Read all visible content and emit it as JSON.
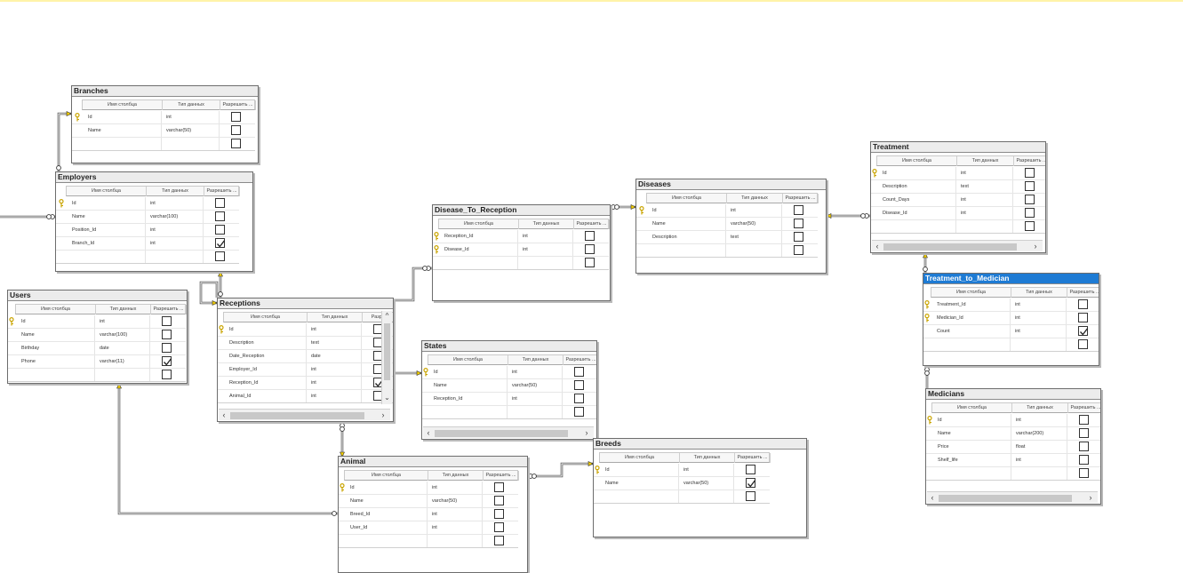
{
  "columns_header": {
    "name": "Имя столбца",
    "type": "Тип данных",
    "nullable": "Разрешить ..."
  },
  "tables": [
    {
      "id": "branches",
      "title": "Branches",
      "rows": [
        {
          "name": "Id",
          "type": "int",
          "pk": true,
          "nullable": false
        },
        {
          "name": "Name",
          "type": "varchar(50)",
          "pk": false,
          "nullable": false
        },
        {
          "name": "",
          "type": "",
          "pk": false,
          "nullable": false
        }
      ]
    },
    {
      "id": "employers",
      "title": "Employers",
      "rows": [
        {
          "name": "Id",
          "type": "int",
          "pk": true,
          "nullable": false
        },
        {
          "name": "Name",
          "type": "varchar(100)",
          "pk": false,
          "nullable": false
        },
        {
          "name": "Position_Id",
          "type": "int",
          "pk": false,
          "nullable": false
        },
        {
          "name": "Branch_Id",
          "type": "int",
          "pk": false,
          "nullable": true
        },
        {
          "name": "",
          "type": "",
          "pk": false,
          "nullable": false
        }
      ]
    },
    {
      "id": "users",
      "title": "Users",
      "rows": [
        {
          "name": "Id",
          "type": "int",
          "pk": true,
          "nullable": false
        },
        {
          "name": "Name",
          "type": "varchar(100)",
          "pk": false,
          "nullable": false
        },
        {
          "name": "Birthday",
          "type": "date",
          "pk": false,
          "nullable": false
        },
        {
          "name": "Phone",
          "type": "varchar(11)",
          "pk": false,
          "nullable": true
        },
        {
          "name": "",
          "type": "",
          "pk": false,
          "nullable": false
        }
      ]
    },
    {
      "id": "receptions",
      "title": "Receptions",
      "header_nullable": "Разреш",
      "rows": [
        {
          "name": "Id",
          "type": "int",
          "pk": true,
          "nullable": false
        },
        {
          "name": "Description",
          "type": "text",
          "pk": false,
          "nullable": false
        },
        {
          "name": "Date_Reception",
          "type": "date",
          "pk": false,
          "nullable": false
        },
        {
          "name": "Employer_Id",
          "type": "int",
          "pk": false,
          "nullable": false
        },
        {
          "name": "Reception_Id",
          "type": "int",
          "pk": false,
          "nullable": true
        },
        {
          "name": "Animal_Id",
          "type": "int",
          "pk": false,
          "nullable": false
        }
      ]
    },
    {
      "id": "disease_to_reception",
      "title": "Disease_To_Reception",
      "rows": [
        {
          "name": "Reception_Id",
          "type": "int",
          "pk": true,
          "nullable": false
        },
        {
          "name": "Disease_Id",
          "type": "int",
          "pk": true,
          "nullable": false
        },
        {
          "name": "",
          "type": "",
          "pk": false,
          "nullable": false
        }
      ]
    },
    {
      "id": "diseases",
      "title": "Diseases",
      "rows": [
        {
          "name": "Id",
          "type": "int",
          "pk": true,
          "nullable": false
        },
        {
          "name": "Name",
          "type": "varchar(50)",
          "pk": false,
          "nullable": false
        },
        {
          "name": "Description",
          "type": "text",
          "pk": false,
          "nullable": false
        },
        {
          "name": "",
          "type": "",
          "pk": false,
          "nullable": false
        }
      ]
    },
    {
      "id": "treatment",
      "title": "Treatment",
      "rows": [
        {
          "name": "Id",
          "type": "int",
          "pk": true,
          "nullable": false
        },
        {
          "name": "Description",
          "type": "text",
          "pk": false,
          "nullable": false
        },
        {
          "name": "Count_Days",
          "type": "int",
          "pk": false,
          "nullable": false
        },
        {
          "name": "Disease_Id",
          "type": "int",
          "pk": false,
          "nullable": false
        },
        {
          "name": "",
          "type": "",
          "pk": false,
          "nullable": false
        }
      ]
    },
    {
      "id": "treatment_to_medician",
      "title": "Treatment_to_Medician",
      "selected": true,
      "rows": [
        {
          "name": "Treatment_Id",
          "type": "int",
          "pk": true,
          "nullable": false
        },
        {
          "name": "Medician_Id",
          "type": "int",
          "pk": true,
          "nullable": false
        },
        {
          "name": "Count",
          "type": "int",
          "pk": false,
          "nullable": true
        },
        {
          "name": "",
          "type": "",
          "pk": false,
          "nullable": false
        }
      ]
    },
    {
      "id": "medicians",
      "title": "Medicians",
      "rows": [
        {
          "name": "Id",
          "type": "int",
          "pk": true,
          "nullable": false
        },
        {
          "name": "Name",
          "type": "varchar(200)",
          "pk": false,
          "nullable": false
        },
        {
          "name": "Price",
          "type": "float",
          "pk": false,
          "nullable": false
        },
        {
          "name": "Shelf_life",
          "type": "int",
          "pk": false,
          "nullable": false
        },
        {
          "name": "",
          "type": "",
          "pk": false,
          "nullable": false
        }
      ]
    },
    {
      "id": "states",
      "title": "States",
      "rows": [
        {
          "name": "Id",
          "type": "int",
          "pk": true,
          "nullable": false
        },
        {
          "name": "Name",
          "type": "varchar(50)",
          "pk": false,
          "nullable": false
        },
        {
          "name": "Reception_Id",
          "type": "int",
          "pk": false,
          "nullable": false
        },
        {
          "name": "",
          "type": "",
          "pk": false,
          "nullable": false
        }
      ]
    },
    {
      "id": "animal",
      "title": "Animal",
      "rows": [
        {
          "name": "Id",
          "type": "int",
          "pk": true,
          "nullable": false
        },
        {
          "name": "Name",
          "type": "varchar(50)",
          "pk": false,
          "nullable": false
        },
        {
          "name": "Breed_Id",
          "type": "int",
          "pk": false,
          "nullable": false
        },
        {
          "name": "User_Id",
          "type": "int",
          "pk": false,
          "nullable": false
        },
        {
          "name": "",
          "type": "",
          "pk": false,
          "nullable": false
        }
      ]
    },
    {
      "id": "breeds",
      "title": "Breeds",
      "rows": [
        {
          "name": "Id",
          "type": "int",
          "pk": true,
          "nullable": false
        },
        {
          "name": "Name",
          "type": "varchar(50)",
          "pk": false,
          "nullable": true
        },
        {
          "name": "",
          "type": "",
          "pk": false,
          "nullable": false
        }
      ]
    }
  ],
  "relationships": [
    {
      "from": "branches",
      "to": "employers"
    },
    {
      "from": "employers",
      "to": "receptions"
    },
    {
      "from": "receptions",
      "to": "receptions"
    },
    {
      "from": "users",
      "to": "animal"
    },
    {
      "from": "receptions",
      "to": "disease_to_reception"
    },
    {
      "from": "diseases",
      "to": "disease_to_reception"
    },
    {
      "from": "diseases",
      "to": "treatment"
    },
    {
      "from": "treatment",
      "to": "treatment_to_medician"
    },
    {
      "from": "medicians",
      "to": "treatment_to_medician"
    },
    {
      "from": "receptions",
      "to": "states"
    },
    {
      "from": "animal",
      "to": "receptions"
    },
    {
      "from": "breeds",
      "to": "animal"
    }
  ],
  "colors": {
    "selected_title": "#1e7bd4",
    "key": "#c9a400",
    "link": "#555555"
  },
  "icons": {
    "primary_key": "key-icon",
    "check": "checkmark-icon",
    "scroll_left": "chevron-left-icon",
    "scroll_right": "chevron-right-icon",
    "scroll_up": "chevron-up-icon",
    "scroll_down": "chevron-down-icon"
  }
}
